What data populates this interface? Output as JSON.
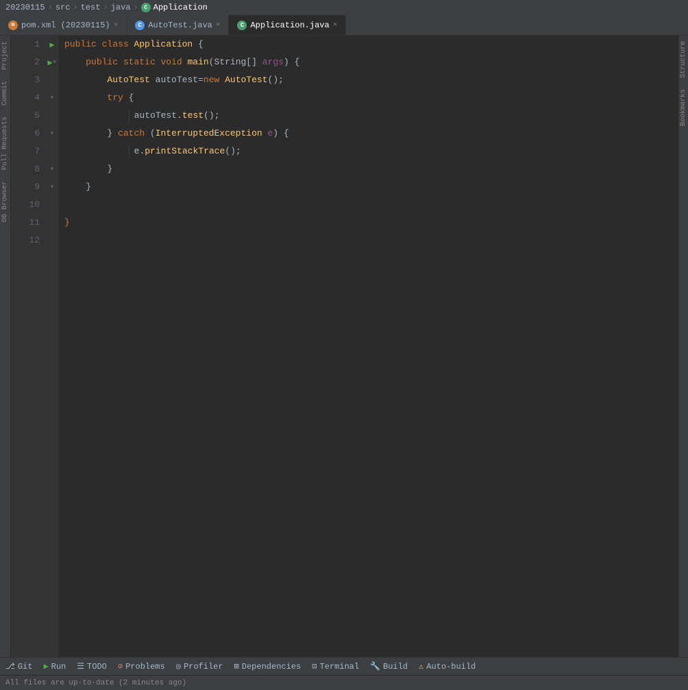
{
  "breadcrumb": {
    "items": [
      "20230115",
      "src",
      "test",
      "java",
      "Application"
    ],
    "separators": [
      ">",
      ">",
      ">",
      ">"
    ]
  },
  "tabs": [
    {
      "id": "pom",
      "label": "pom.xml (20230115)",
      "icon": "maven",
      "active": false
    },
    {
      "id": "autotest",
      "label": "AutoTest.java",
      "icon": "java-blue",
      "active": false
    },
    {
      "id": "application",
      "label": "Application.java",
      "icon": "java-green",
      "active": true
    }
  ],
  "code": {
    "lines": [
      {
        "num": 1,
        "gutter": "run",
        "content": "public class Application {"
      },
      {
        "num": 2,
        "gutter": "run-fold",
        "content": "    public static void main(String[] args) {"
      },
      {
        "num": 3,
        "gutter": "",
        "content": "        AutoTest autoTest=new AutoTest();"
      },
      {
        "num": 4,
        "gutter": "fold",
        "content": "        try {"
      },
      {
        "num": 5,
        "gutter": "",
        "content": "            autoTest.test();"
      },
      {
        "num": 6,
        "gutter": "fold",
        "content": "        } catch (InterruptedException e) {"
      },
      {
        "num": 7,
        "gutter": "",
        "content": "            e.printStackTrace();"
      },
      {
        "num": 8,
        "gutter": "fold",
        "content": "        }"
      },
      {
        "num": 9,
        "gutter": "fold",
        "content": "    }"
      },
      {
        "num": 10,
        "gutter": "",
        "content": ""
      },
      {
        "num": 11,
        "gutter": "",
        "content": "}"
      },
      {
        "num": 12,
        "gutter": "",
        "content": ""
      }
    ]
  },
  "toolbar": {
    "items": [
      {
        "id": "git",
        "icon": "⎇",
        "label": "Git"
      },
      {
        "id": "run",
        "icon": "▶",
        "label": "Run"
      },
      {
        "id": "todo",
        "icon": "☰",
        "label": "TODO"
      },
      {
        "id": "problems",
        "icon": "⚠",
        "label": "Problems"
      },
      {
        "id": "profiler",
        "icon": "◎",
        "label": "Profiler"
      },
      {
        "id": "dependencies",
        "icon": "⊞",
        "label": "Dependencies"
      },
      {
        "id": "terminal",
        "icon": "⊡",
        "label": "Terminal"
      },
      {
        "id": "build",
        "icon": "🔧",
        "label": "Build"
      },
      {
        "id": "autobuild",
        "icon": "⚠",
        "label": "Auto-build"
      }
    ]
  },
  "status": {
    "text": "All files are up-to-date (2 minutes ago)"
  },
  "sidebar": {
    "left_labels": [
      "Project",
      "Commit",
      "Pull Requests",
      "DB Browser"
    ],
    "right_labels": [
      "Structure",
      "Bookmarks"
    ]
  }
}
